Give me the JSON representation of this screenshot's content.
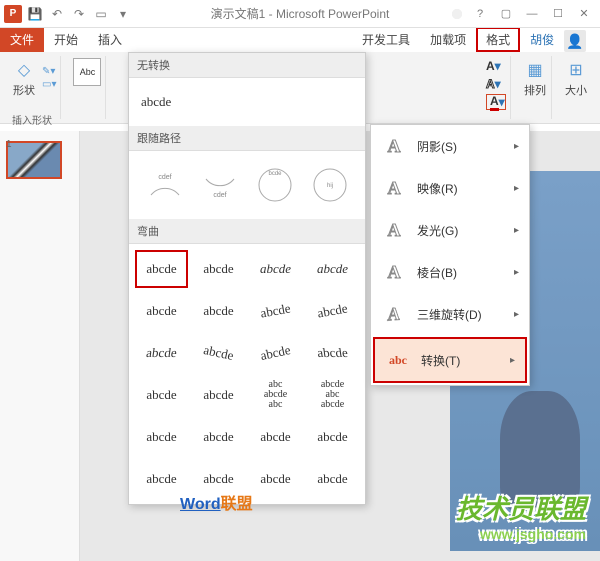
{
  "titlebar": {
    "app_icon": "P",
    "title": "演示文稿1 - Microsoft PowerPoint",
    "user_name": "胡俊"
  },
  "tabs": {
    "file": "文件",
    "home": "开始",
    "insert": "插入",
    "dev": "开发工具",
    "addins": "加载项",
    "format": "格式"
  },
  "ribbon": {
    "shape_label": "形状",
    "insert_shape_label": "插入形状",
    "abc_sample": "Abc",
    "arrange_label": "排列",
    "size_label": "大小"
  },
  "thumbnail": {
    "num": "1"
  },
  "transform_panel": {
    "no_transform_header": "无转换",
    "sample_text": "abcde",
    "follow_path_header": "跟随路径",
    "curve_header": "弯曲"
  },
  "curve_samples": [
    "abcde",
    "abcde",
    "abcde",
    "abcde",
    "abcde",
    "abcde",
    "abcde",
    "abcde",
    "abcde",
    "abcde",
    "abcde",
    "abcde",
    "abcde",
    "abcde",
    "abcde",
    "abcde",
    "abcde",
    "abcde",
    "abcde",
    "abcde",
    "abcde",
    "abcde",
    "abcde",
    "abcde"
  ],
  "effects_menu": {
    "shadow": "阴影(S)",
    "reflection": "映像(R)",
    "glow": "发光(G)",
    "bevel": "棱台(B)",
    "rotation3d": "三维旋转(D)",
    "transform": "转换(T)"
  },
  "watermark": {
    "word": "Word",
    "union": "联盟"
  },
  "big_watermark": {
    "text": "技术员联盟",
    "url": "www.jsgho.com"
  }
}
